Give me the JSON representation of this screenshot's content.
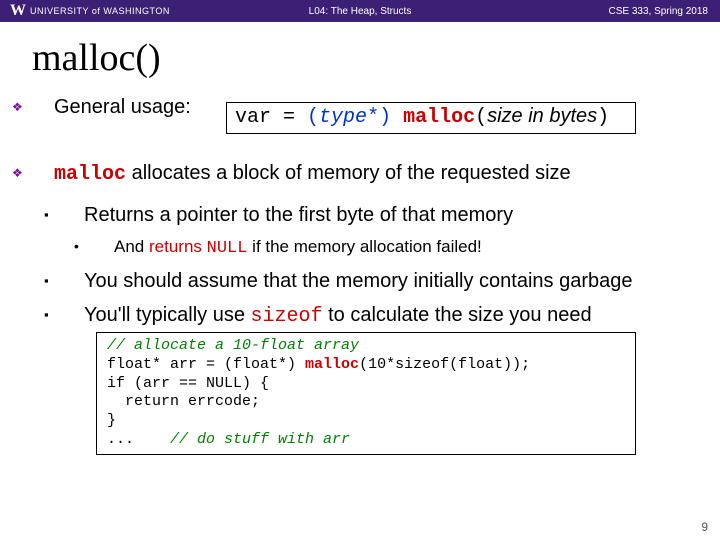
{
  "hdr": {
    "logo": "W",
    "uni": "UNIVERSITY of WASHINGTON",
    "center": "L04: The Heap, Structs",
    "right": "CSE 333, Spring 2018"
  },
  "title": "malloc()",
  "sig": {
    "var": "var",
    "eq": " = ",
    "cast_open": "(",
    "type": "type",
    "cast_close": "*) ",
    "fn": "malloc",
    "paren": "(",
    "arg": "size in bytes",
    "close": ")"
  },
  "p1_lead": "General usage:",
  "p2_a": "malloc",
  "p2_b": " allocates a block of memory of the requested size",
  "p3": "Returns a pointer to the first byte of that memory",
  "p4_a": "And ",
  "p4_b": "returns ",
  "p4_c": "NULL",
  "p4_d": " if the memory allocation failed!",
  "p5": "You should assume that the memory initially contains garbage",
  "p6_a": "You'll typically use ",
  "p6_b": "sizeof",
  "p6_c": " to calculate the size you need",
  "code": {
    "l1": "// allocate a 10-float array",
    "l2a": "float* arr = (float*) ",
    "l2b": "malloc",
    "l2c": "(10*sizeof(float));",
    "l3": "if (arr == NULL) {",
    "l4": "  return errcode;",
    "l5": "}",
    "l6a": "...    ",
    "l6b": "// do stuff with arr"
  },
  "page": "9"
}
